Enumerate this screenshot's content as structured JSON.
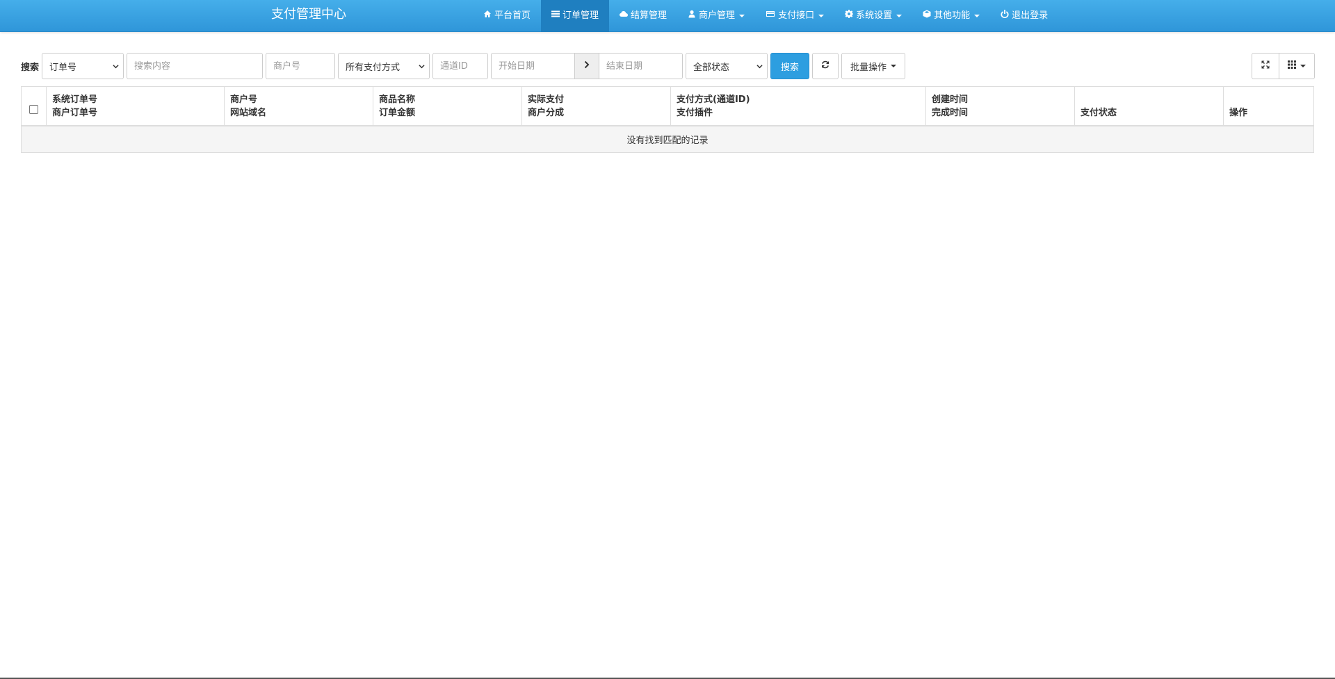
{
  "navbar": {
    "brand": "支付管理中心",
    "items": [
      {
        "label": "平台首页",
        "icon": "home-icon",
        "dropdown": false,
        "active": false
      },
      {
        "label": "订单管理",
        "icon": "list-icon",
        "dropdown": false,
        "active": true
      },
      {
        "label": "结算管理",
        "icon": "cloud-icon",
        "dropdown": false,
        "active": false
      },
      {
        "label": "商户管理",
        "icon": "user-icon",
        "dropdown": true,
        "active": false
      },
      {
        "label": "支付接口",
        "icon": "credit-card-icon",
        "dropdown": true,
        "active": false
      },
      {
        "label": "系统设置",
        "icon": "gear-icon",
        "dropdown": true,
        "active": false
      },
      {
        "label": "其他功能",
        "icon": "cube-icon",
        "dropdown": true,
        "active": false
      },
      {
        "label": "退出登录",
        "icon": "power-icon",
        "dropdown": false,
        "active": false
      }
    ]
  },
  "toolbar": {
    "search_label": "搜索",
    "field_select": "订单号",
    "search_placeholder": "搜索内容",
    "merchant_placeholder": "商户号",
    "paytype_select": "所有支付方式",
    "channel_placeholder": "通道ID",
    "start_date_placeholder": "开始日期",
    "end_date_placeholder": "结束日期",
    "status_select": "全部状态",
    "search_button": "搜索",
    "batch_button": "批量操作"
  },
  "table": {
    "columns": [
      {
        "line1": "系统订单号",
        "line2": "商户订单号"
      },
      {
        "line1": "商户号",
        "line2": "网站域名"
      },
      {
        "line1": "商品名称",
        "line2": "订单金额"
      },
      {
        "line1": "实际支付",
        "line2": "商户分成"
      },
      {
        "line1": "支付方式(通道ID)",
        "line2": "支付插件"
      },
      {
        "line1": "创建时间",
        "line2": "完成时间"
      },
      {
        "line1": "",
        "line2": "支付状态"
      },
      {
        "line1": "",
        "line2": "操作"
      }
    ],
    "empty_text": "没有找到匹配的记录"
  },
  "colors": {
    "navbar": "#3aa3e3",
    "active_nav": "#1f7fc0",
    "primary_button": "#2d9ee0"
  }
}
